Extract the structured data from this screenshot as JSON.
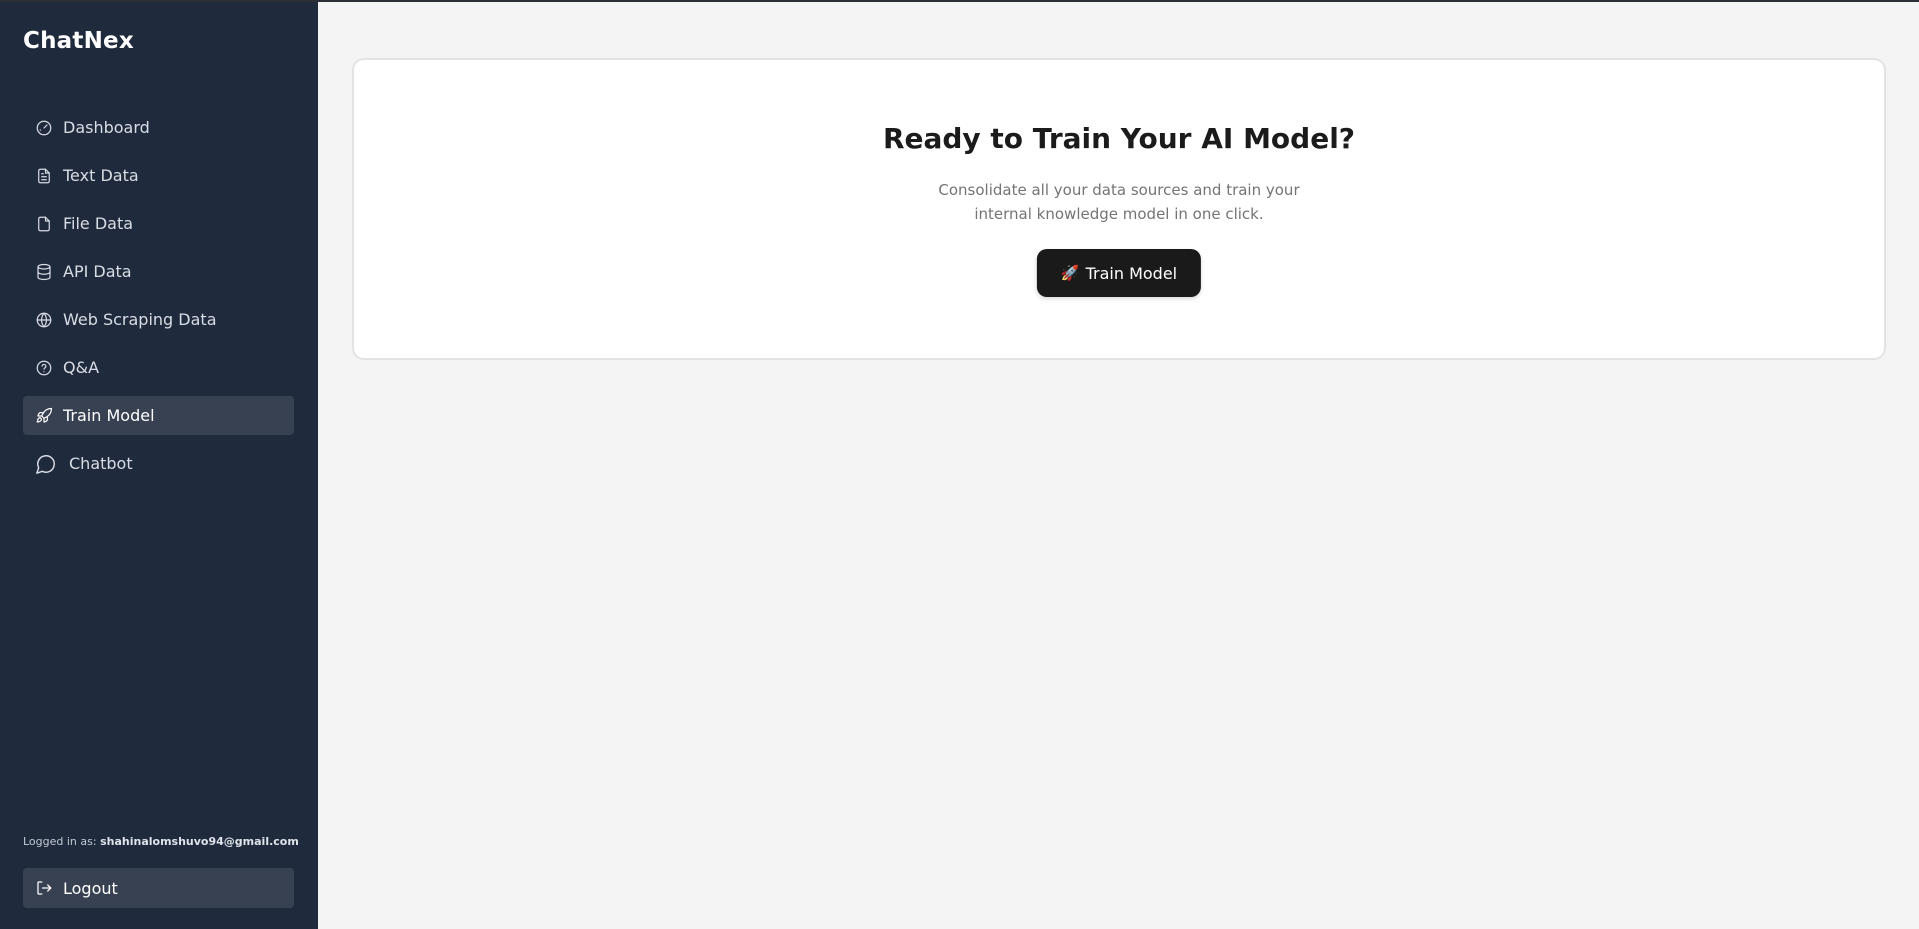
{
  "app": {
    "brand": "ChatNex"
  },
  "sidebar": {
    "items": [
      {
        "label": "Dashboard",
        "icon": "gauge-icon"
      },
      {
        "label": "Text Data",
        "icon": "document-text-icon"
      },
      {
        "label": "File Data",
        "icon": "file-icon"
      },
      {
        "label": "API Data",
        "icon": "database-icon"
      },
      {
        "label": "Web Scraping Data",
        "icon": "globe-icon"
      },
      {
        "label": "Q&A",
        "icon": "help-circle-icon"
      },
      {
        "label": "Train Model",
        "icon": "rocket-icon",
        "active": true
      },
      {
        "label": "Chatbot",
        "icon": "chat-bubble-icon"
      }
    ],
    "logged_in_label": "Logged in as:",
    "user_email": "shahinalomshuvo94@gmail.com",
    "logout_label": "Logout"
  },
  "main": {
    "card": {
      "title": "Ready to Train Your AI Model?",
      "subtitle": "Consolidate all your data sources and train your internal knowledge model in one click.",
      "button_icon": "🚀",
      "button_label": "Train Model"
    }
  },
  "colors": {
    "sidebar_bg": "#1f2a3c",
    "active_item_bg": "#374152",
    "page_bg": "#f4f4f4",
    "button_bg": "#1a1a1a"
  }
}
